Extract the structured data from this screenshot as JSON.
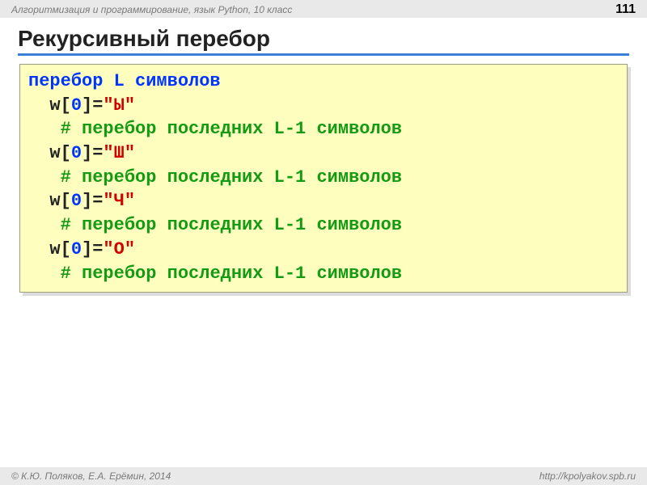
{
  "header": {
    "left": "Алгоритмизация и программирование, язык Python, 10 класс",
    "page_number": "111"
  },
  "title": "Рекурсивный перебор",
  "code": {
    "line1_a": "перебор L символов",
    "assign": {
      "w": "w[",
      "idx": "0",
      "eq": "]=",
      "letters": [
        "\"Ы\"",
        "\"Ш\"",
        "\"Ч\"",
        "\"О\""
      ]
    },
    "comment": "# перебор последних L-1 символов"
  },
  "footer": {
    "left": "© К.Ю. Поляков, Е.А. Ерёмин, 2014",
    "right": "http://kpolyakov.spb.ru"
  }
}
